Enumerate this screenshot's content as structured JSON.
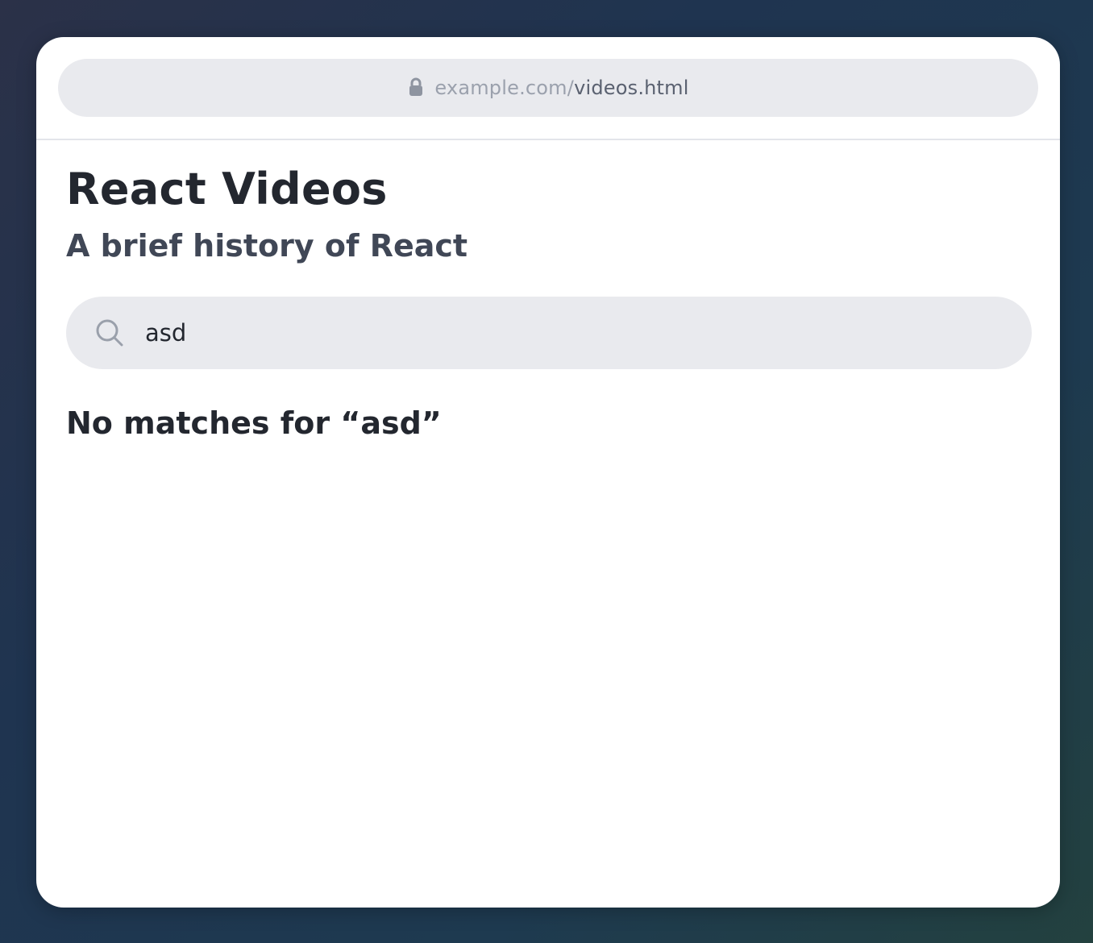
{
  "browser": {
    "url_domain": "example.com/",
    "url_path": "videos.html"
  },
  "page": {
    "title": "React Videos",
    "subtitle": "A brief history of React"
  },
  "search": {
    "value": "asd",
    "icon": "search-icon"
  },
  "results": {
    "empty_message": "No matches for “asd”"
  }
}
